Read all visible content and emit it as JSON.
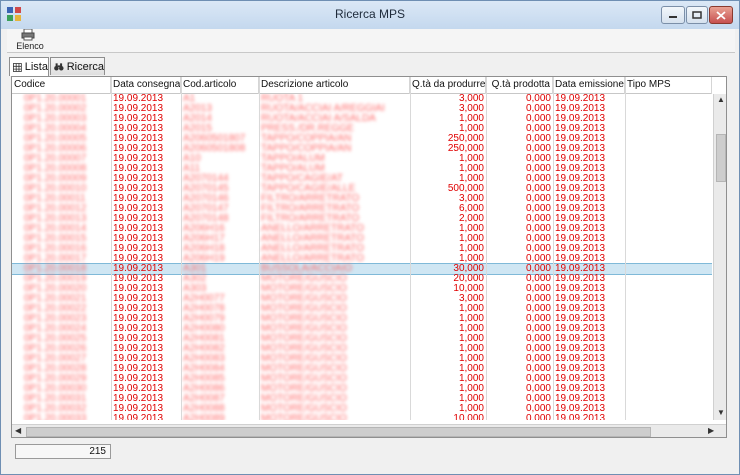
{
  "window": {
    "title": "Ricerca MPS"
  },
  "toolbar": {
    "elenco_label": "Elenco"
  },
  "tabs": [
    {
      "label": "Lista",
      "icon": "grid-icon",
      "active": true
    },
    {
      "label": "Ricerca",
      "icon": "binoculars-icon",
      "active": false
    }
  ],
  "grid": {
    "columns": [
      "Codice",
      "Data consegna",
      "Cod.articolo",
      "Descrizione articolo",
      "Q.tà da produrre",
      "Q.tà prodotta",
      "Data emissione",
      "Tipo MPS"
    ],
    "rows": [
      {
        "code": "0P1.20.00001",
        "date": "19.09.2013",
        "art": "A1",
        "desc": "RUOTA 1",
        "qty": "3,000",
        "prod": "0,000",
        "emit": "19.09.2013"
      },
      {
        "code": "0P1.20.00002",
        "date": "19.09.2013",
        "art": "A2013",
        "desc": "RUOTA/ACCIAI A/REGGIAI",
        "qty": "3,000",
        "prod": "0,000",
        "emit": "19.09.2013"
      },
      {
        "code": "0P1.20.00003",
        "date": "19.09.2013",
        "art": "A2014",
        "desc": "RUOTA/ACCIAI A/SALDA",
        "qty": "1,000",
        "prod": "0,000",
        "emit": "19.09.2013"
      },
      {
        "code": "0P1.20.00004",
        "date": "19.09.2013",
        "art": "A2015",
        "desc": "PRESS./DR.REGGE",
        "qty": "1,000",
        "prod": "0,000",
        "emit": "19.09.2013"
      },
      {
        "code": "0P1.20.00005",
        "date": "19.09.2013",
        "art": "A2060501807",
        "desc": "TAPPO/COPPIA/AN",
        "qty": "250,000",
        "prod": "0,000",
        "emit": "19.09.2013"
      },
      {
        "code": "0P1.20.00006",
        "date": "19.09.2013",
        "art": "A2060501808",
        "desc": "TAPPO/COPPIA/AN",
        "qty": "250,000",
        "prod": "0,000",
        "emit": "19.09.2013"
      },
      {
        "code": "0P1.20.00007",
        "date": "19.09.2013",
        "art": "A10",
        "desc": "TAPPO/ALUM",
        "qty": "1,000",
        "prod": "0,000",
        "emit": "19.09.2013"
      },
      {
        "code": "0P1.20.00008",
        "date": "19.09.2013",
        "art": "A11",
        "desc": "TAPPO/ALUM",
        "qty": "1,000",
        "prod": "0,000",
        "emit": "19.09.2013"
      },
      {
        "code": "0P1.20.00009",
        "date": "19.09.2013",
        "art": "A2070144",
        "desc": "TAPPO/CAGIE/AT",
        "qty": "1,000",
        "prod": "0,000",
        "emit": "19.09.2013"
      },
      {
        "code": "0P1.20.00010",
        "date": "19.09.2013",
        "art": "A2070145",
        "desc": "TAPPO/CAGIE/ALLE",
        "qty": "500,000",
        "prod": "0,000",
        "emit": "19.09.2013"
      },
      {
        "code": "0P1.20.00011",
        "date": "19.09.2013",
        "art": "A2070146",
        "desc": "FILTRO/ARRETRATO",
        "qty": "3,000",
        "prod": "0,000",
        "emit": "19.09.2013"
      },
      {
        "code": "0P1.20.00012",
        "date": "19.09.2013",
        "art": "A2070147",
        "desc": "FILTRO/ARRETRATO",
        "qty": "6,000",
        "prod": "0,000",
        "emit": "19.09.2013"
      },
      {
        "code": "0P1.20.00013",
        "date": "19.09.2013",
        "art": "A2070148",
        "desc": "FILTRO/ARRETRATO",
        "qty": "2,000",
        "prod": "0,000",
        "emit": "19.09.2013"
      },
      {
        "code": "0P1.20.00014",
        "date": "19.09.2013",
        "art": "A206H16",
        "desc": "ANELLO/ARRETRATO",
        "qty": "1,000",
        "prod": "0,000",
        "emit": "19.09.2013"
      },
      {
        "code": "0P1.20.00015",
        "date": "19.09.2013",
        "art": "A206H17",
        "desc": "ANELLO/ARRETRATO",
        "qty": "1,000",
        "prod": "0,000",
        "emit": "19.09.2013"
      },
      {
        "code": "0P1.20.00016",
        "date": "19.09.2013",
        "art": "A206H18",
        "desc": "ANELLO/ARRETRATO",
        "qty": "1,000",
        "prod": "0,000",
        "emit": "19.09.2013"
      },
      {
        "code": "0P1.20.00017",
        "date": "19.09.2013",
        "art": "A206H19",
        "desc": "ANELLO/ARRETRATO",
        "qty": "1,000",
        "prod": "0,000",
        "emit": "19.09.2013"
      },
      {
        "code": "0P1.20.00018",
        "date": "19.09.2013",
        "art": "A301",
        "desc": "BUSSOLA/ACCIAIO",
        "qty": "30,000",
        "prod": "0,000",
        "emit": "19.09.2013"
      },
      {
        "code": "0P1.20.00019",
        "date": "19.09.2013",
        "art": "A302",
        "desc": "MOTORE/GUSCIO",
        "qty": "20,000",
        "prod": "0,000",
        "emit": "19.09.2013"
      },
      {
        "code": "0P1.20.00020",
        "date": "19.09.2013",
        "art": "A303",
        "desc": "MOTORE/GUSCIO",
        "qty": "10,000",
        "prod": "0,000",
        "emit": "19.09.2013"
      },
      {
        "code": "0P1.20.00021",
        "date": "19.09.2013",
        "art": "A2H0077",
        "desc": "MOTORE/GUSCIO",
        "qty": "3,000",
        "prod": "0,000",
        "emit": "19.09.2013"
      },
      {
        "code": "0P1.20.00022",
        "date": "19.09.2013",
        "art": "A2H0078",
        "desc": "MOTORE/GUSCIO",
        "qty": "1,000",
        "prod": "0,000",
        "emit": "19.09.2013"
      },
      {
        "code": "0P1.20.00023",
        "date": "19.09.2013",
        "art": "A2H0079",
        "desc": "MOTORE/GUSCIO",
        "qty": "1,000",
        "prod": "0,000",
        "emit": "19.09.2013"
      },
      {
        "code": "0P1.20.00024",
        "date": "19.09.2013",
        "art": "A2H0080",
        "desc": "MOTORE/GUSCIO",
        "qty": "1,000",
        "prod": "0,000",
        "emit": "19.09.2013"
      },
      {
        "code": "0P1.20.00025",
        "date": "19.09.2013",
        "art": "A2H0081",
        "desc": "MOTORE/GUSCIO",
        "qty": "1,000",
        "prod": "0,000",
        "emit": "19.09.2013"
      },
      {
        "code": "0P1.20.00026",
        "date": "19.09.2013",
        "art": "A2H0082",
        "desc": "MOTORE/GUSCIO",
        "qty": "1,000",
        "prod": "0,000",
        "emit": "19.09.2013"
      },
      {
        "code": "0P1.20.00027",
        "date": "19.09.2013",
        "art": "A2H0083",
        "desc": "MOTORE/GUSCIO",
        "qty": "1,000",
        "prod": "0,000",
        "emit": "19.09.2013"
      },
      {
        "code": "0P1.20.00028",
        "date": "19.09.2013",
        "art": "A2H0084",
        "desc": "MOTORE/GUSCIO",
        "qty": "1,000",
        "prod": "0,000",
        "emit": "19.09.2013"
      },
      {
        "code": "0P1.20.00029",
        "date": "19.09.2013",
        "art": "A2H0085",
        "desc": "MOTORE/GUSCIO",
        "qty": "1,000",
        "prod": "0,000",
        "emit": "19.09.2013"
      },
      {
        "code": "0P1.20.00030",
        "date": "19.09.2013",
        "art": "A2H0086",
        "desc": "MOTORE/GUSCIO",
        "qty": "1,000",
        "prod": "0,000",
        "emit": "19.09.2013"
      },
      {
        "code": "0P1.20.00031",
        "date": "19.09.2013",
        "art": "A2H0087",
        "desc": "MOTORE/GUSCIO",
        "qty": "1,000",
        "prod": "0,000",
        "emit": "19.09.2013"
      },
      {
        "code": "0P1.20.00032",
        "date": "19.09.2013",
        "art": "A2H0088",
        "desc": "MOTORE/GUSCIO",
        "qty": "1,000",
        "prod": "0,000",
        "emit": "19.09.2013"
      },
      {
        "code": "0P1.20.00033",
        "date": "19.09.2013",
        "art": "A2H0089",
        "desc": "MOTORE/GUSCIO",
        "qty": "10,000",
        "prod": "0,000",
        "emit": "19.09.2013"
      }
    ],
    "selected_index": 17
  },
  "status": {
    "count": "215"
  },
  "colors": {
    "row_text": "#e00000",
    "selection": "#cfe6f3"
  }
}
